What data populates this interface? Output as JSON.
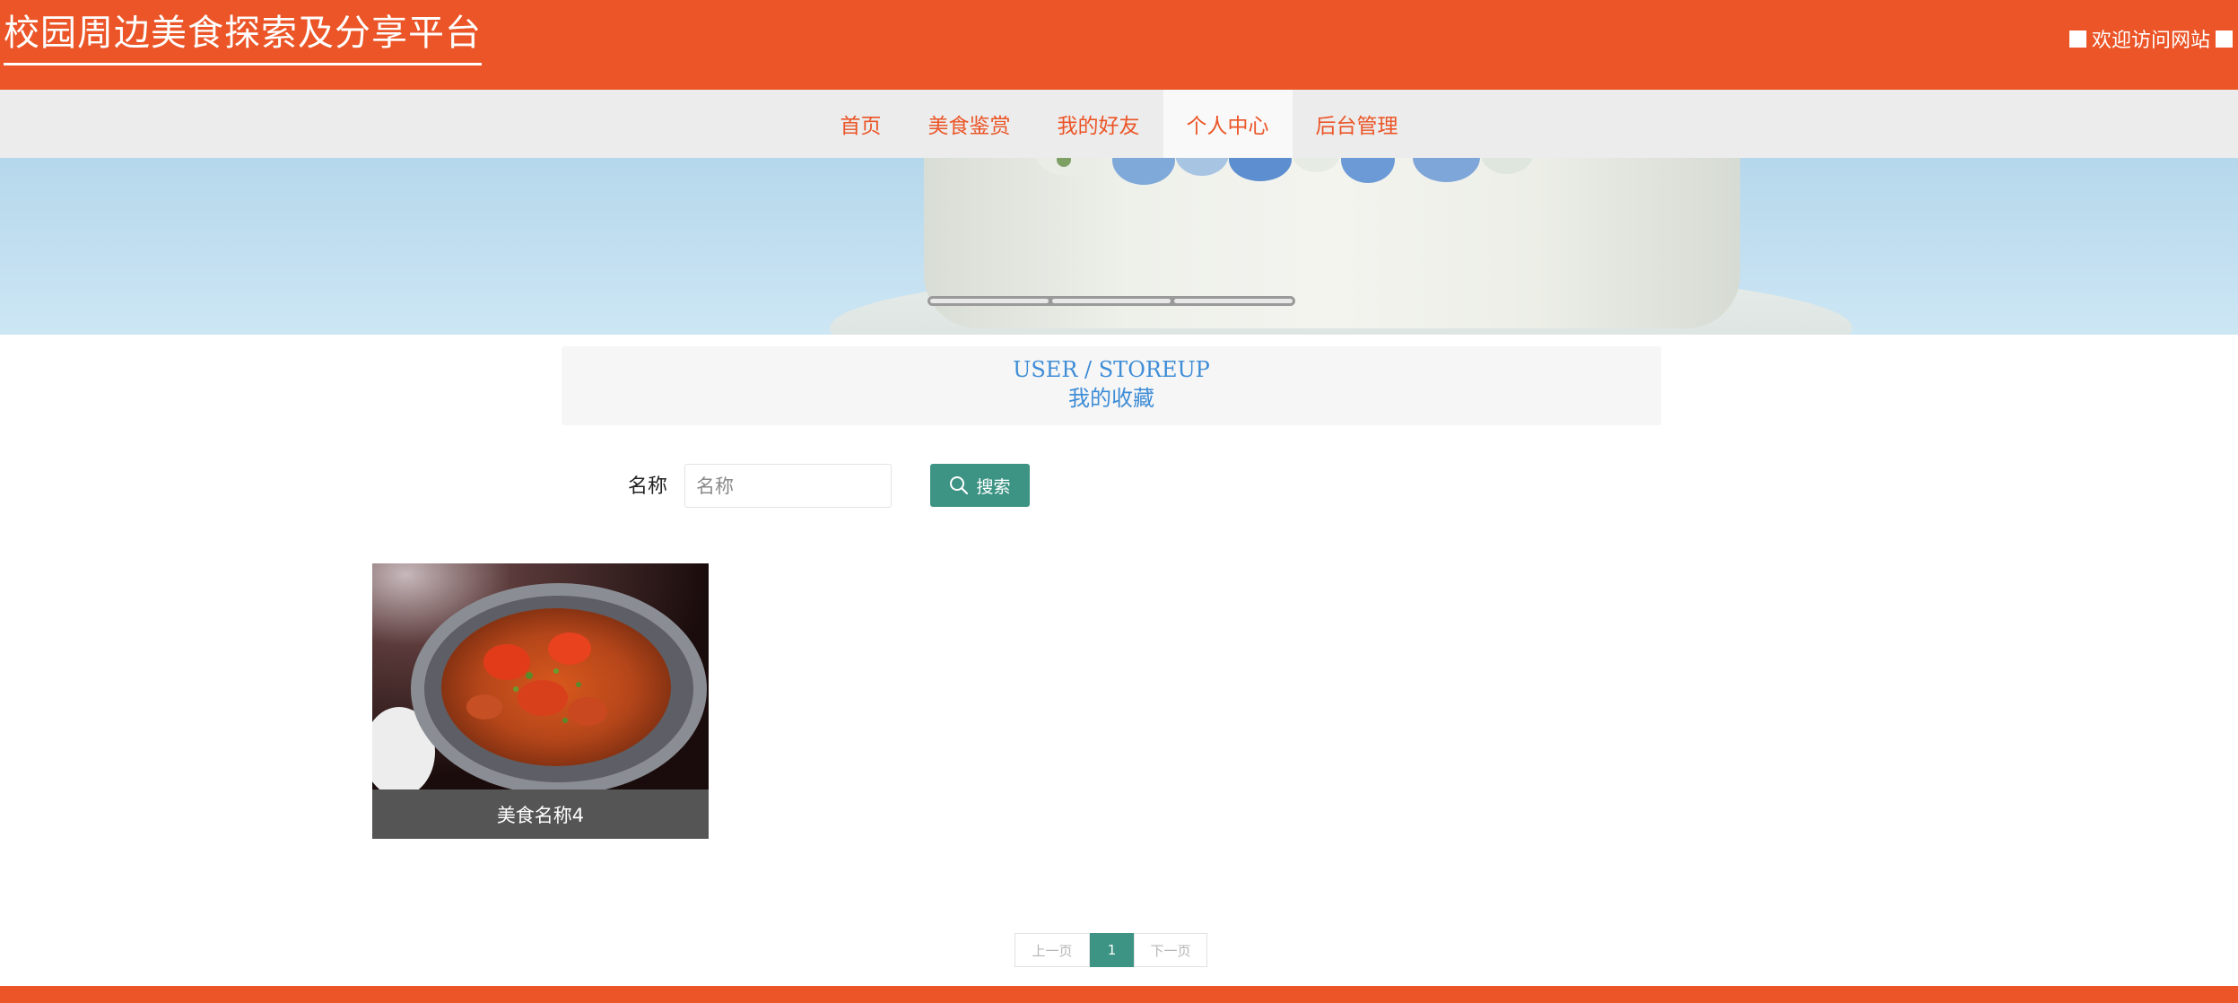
{
  "header": {
    "site_title": "校园周边美食探索及分享平台",
    "welcome_text": "欢迎访问网站"
  },
  "nav": {
    "items": [
      {
        "label": "首页"
      },
      {
        "label": "美食鉴赏"
      },
      {
        "label": "我的好友"
      },
      {
        "label": "个人中心"
      },
      {
        "label": "后台管理"
      }
    ],
    "active_index": 3
  },
  "banner": {
    "slide_count": 3
  },
  "section": {
    "en_title": "USER / STOREUP",
    "cn_title": "我的收藏"
  },
  "search": {
    "label": "名称",
    "placeholder": "名称",
    "value": "",
    "button_label": "搜索",
    "button_icon": "search-icon"
  },
  "items": [
    {
      "name": "美食名称4"
    }
  ],
  "pagination": {
    "prev_label": "上一页",
    "current_page": "1",
    "next_label": "下一页"
  },
  "colors": {
    "brand": "#eb5527",
    "accent": "#3d9484",
    "heading_blue": "#3f8dd6"
  }
}
